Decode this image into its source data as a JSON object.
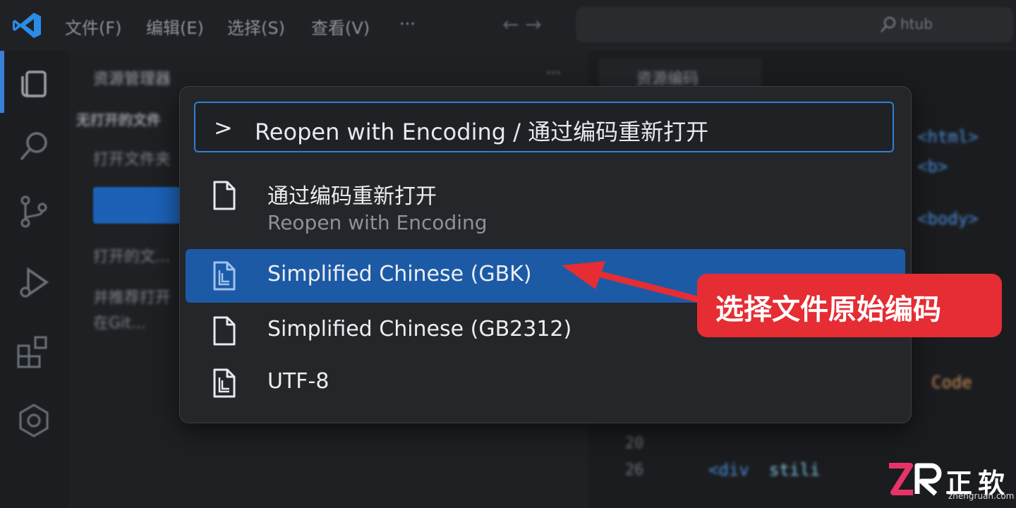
{
  "titlebar": {
    "menu": [
      "文件(F)",
      "编辑(E)",
      "选择(S)",
      "查看(V)",
      "···"
    ],
    "search_hint": "htub"
  },
  "sidebar": {
    "title": "资源管理器",
    "more": "···",
    "section": "无打开的文件",
    "line1": "打开文件夹",
    "line2": "打开的文...",
    "line3": "并推荐打开",
    "line4": "在Git..."
  },
  "editor": {
    "tab_label": "资源编码"
  },
  "palette": {
    "prompt": ">",
    "query": "Reopen with Encoding / 通过编码重新打开",
    "items": [
      {
        "label": "通过编码重新打开",
        "sublabel": "Reopen with Encoding"
      },
      {
        "label": "Simplified Chinese (GBK)",
        "selected": true
      },
      {
        "label": "Simplified Chinese (GB2312)"
      },
      {
        "label": "UTF-8"
      }
    ]
  },
  "annotation": {
    "text": "选择文件原始编码",
    "color": "#e52d33"
  },
  "watermark": {
    "brand_cn": "正软",
    "url": "zhengruan.com"
  },
  "colors": {
    "accent": "#2f7fd8",
    "selection": "#1c5aa6"
  }
}
